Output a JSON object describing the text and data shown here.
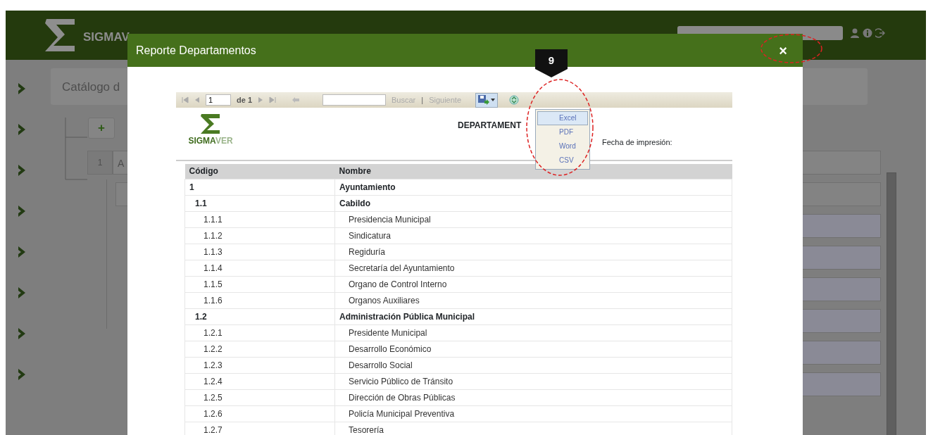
{
  "app": {
    "brand": "SIGMAV",
    "breadcrumb": "Catálogo d",
    "tree": {
      "add_button": "+",
      "node_code": "1",
      "node_label": "A"
    }
  },
  "modal": {
    "title": "Reporte Departamentos",
    "close": "×",
    "annotation_marker": "9",
    "toolbar": {
      "page": "1",
      "page_count": "de 1",
      "find_link": "Buscar",
      "separator": "|",
      "next_link": "Siguiente"
    },
    "export_menu": [
      {
        "label": "Excel",
        "selected": true
      },
      {
        "label": "PDF",
        "selected": false
      },
      {
        "label": "Word",
        "selected": false
      },
      {
        "label": "CSV",
        "selected": false
      }
    ],
    "report": {
      "logo_primary": "SIGMA",
      "logo_secondary": "VER",
      "title": "DEPARTAMENT",
      "date_label": "Fecha de impresión:",
      "columns": [
        "Código",
        "Nombre"
      ],
      "rows": [
        {
          "code": "1",
          "name": "Ayuntamiento",
          "children": [
            {
              "code": "1.1",
              "name": "Cabildo",
              "children": [
                {
                  "code": "1.1.1",
                  "name": "Presidencia Municipal"
                },
                {
                  "code": "1.1.2",
                  "name": "Sindicatura"
                },
                {
                  "code": "1.1.3",
                  "name": "Regiduría"
                },
                {
                  "code": "1.1.4",
                  "name": "Secretaría del Ayuntamiento"
                },
                {
                  "code": "1.1.5",
                  "name": "Organo de Control Interno"
                },
                {
                  "code": "1.1.6",
                  "name": "Organos Auxiliares"
                }
              ]
            },
            {
              "code": "1.2",
              "name": "Administración Pública Municipal",
              "children": [
                {
                  "code": "1.2.1",
                  "name": "Presidente Municipal"
                },
                {
                  "code": "1.2.2",
                  "name": "Desarrollo Económico"
                },
                {
                  "code": "1.2.3",
                  "name": "Desarrollo Social"
                },
                {
                  "code": "1.2.4",
                  "name": "Servicio Público de Tránsito"
                },
                {
                  "code": "1.2.5",
                  "name": "Dirección de Obras Públicas"
                },
                {
                  "code": "1.2.6",
                  "name": "Policía Municipal Preventiva"
                },
                {
                  "code": "1.2.7",
                  "name": "Tesorería"
                }
              ]
            }
          ]
        }
      ]
    }
  }
}
